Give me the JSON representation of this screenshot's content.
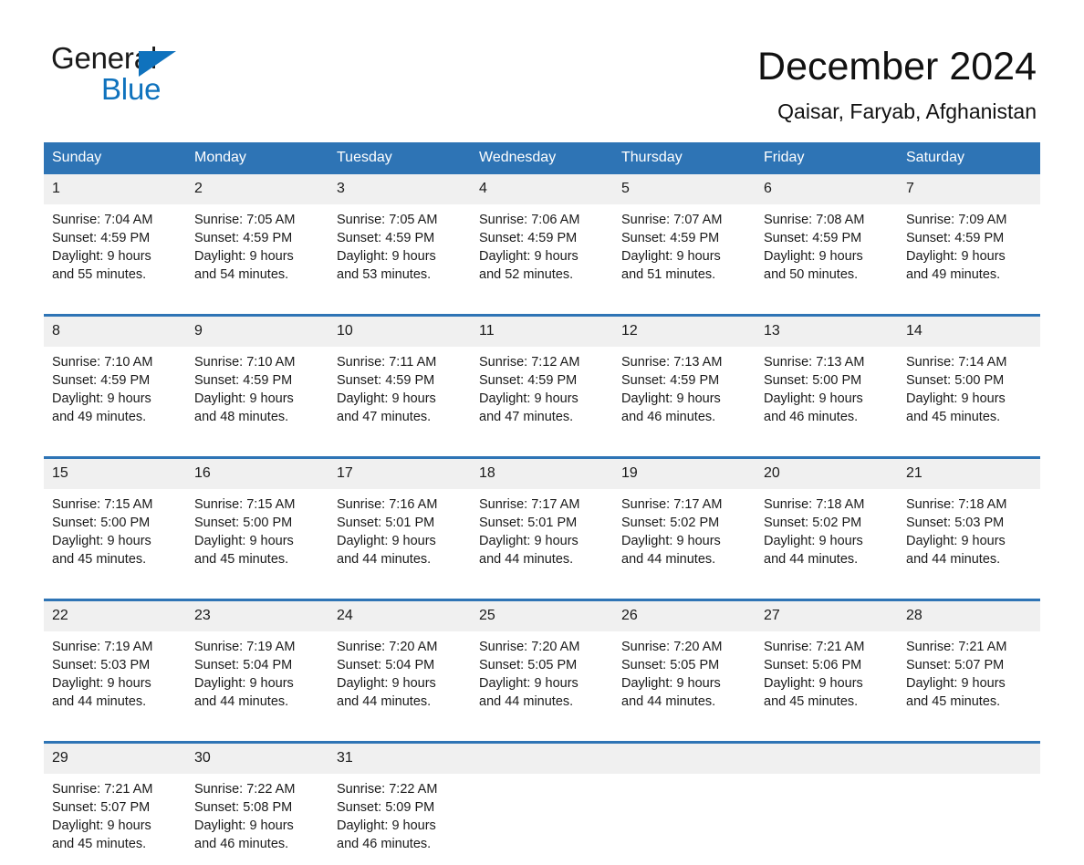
{
  "brand": {
    "name_part1": "General",
    "name_part2": "Blue",
    "triangle_color": "#0f72bd"
  },
  "header": {
    "title": "December 2024",
    "location": "Qaisar, Faryab, Afghanistan"
  },
  "theme": {
    "header_blue": "#2e74b5",
    "number_band": "#f0f0f0",
    "text": "#1a1a1a"
  },
  "calendar": {
    "day_names": [
      "Sunday",
      "Monday",
      "Tuesday",
      "Wednesday",
      "Thursday",
      "Friday",
      "Saturday"
    ],
    "weeks": [
      {
        "days": [
          {
            "num": "1",
            "l1": "Sunrise: 7:04 AM",
            "l2": "Sunset: 4:59 PM",
            "l3": "Daylight: 9 hours",
            "l4": "and 55 minutes."
          },
          {
            "num": "2",
            "l1": "Sunrise: 7:05 AM",
            "l2": "Sunset: 4:59 PM",
            "l3": "Daylight: 9 hours",
            "l4": "and 54 minutes."
          },
          {
            "num": "3",
            "l1": "Sunrise: 7:05 AM",
            "l2": "Sunset: 4:59 PM",
            "l3": "Daylight: 9 hours",
            "l4": "and 53 minutes."
          },
          {
            "num": "4",
            "l1": "Sunrise: 7:06 AM",
            "l2": "Sunset: 4:59 PM",
            "l3": "Daylight: 9 hours",
            "l4": "and 52 minutes."
          },
          {
            "num": "5",
            "l1": "Sunrise: 7:07 AM",
            "l2": "Sunset: 4:59 PM",
            "l3": "Daylight: 9 hours",
            "l4": "and 51 minutes."
          },
          {
            "num": "6",
            "l1": "Sunrise: 7:08 AM",
            "l2": "Sunset: 4:59 PM",
            "l3": "Daylight: 9 hours",
            "l4": "and 50 minutes."
          },
          {
            "num": "7",
            "l1": "Sunrise: 7:09 AM",
            "l2": "Sunset: 4:59 PM",
            "l3": "Daylight: 9 hours",
            "l4": "and 49 minutes."
          }
        ]
      },
      {
        "days": [
          {
            "num": "8",
            "l1": "Sunrise: 7:10 AM",
            "l2": "Sunset: 4:59 PM",
            "l3": "Daylight: 9 hours",
            "l4": "and 49 minutes."
          },
          {
            "num": "9",
            "l1": "Sunrise: 7:10 AM",
            "l2": "Sunset: 4:59 PM",
            "l3": "Daylight: 9 hours",
            "l4": "and 48 minutes."
          },
          {
            "num": "10",
            "l1": "Sunrise: 7:11 AM",
            "l2": "Sunset: 4:59 PM",
            "l3": "Daylight: 9 hours",
            "l4": "and 47 minutes."
          },
          {
            "num": "11",
            "l1": "Sunrise: 7:12 AM",
            "l2": "Sunset: 4:59 PM",
            "l3": "Daylight: 9 hours",
            "l4": "and 47 minutes."
          },
          {
            "num": "12",
            "l1": "Sunrise: 7:13 AM",
            "l2": "Sunset: 4:59 PM",
            "l3": "Daylight: 9 hours",
            "l4": "and 46 minutes."
          },
          {
            "num": "13",
            "l1": "Sunrise: 7:13 AM",
            "l2": "Sunset: 5:00 PM",
            "l3": "Daylight: 9 hours",
            "l4": "and 46 minutes."
          },
          {
            "num": "14",
            "l1": "Sunrise: 7:14 AM",
            "l2": "Sunset: 5:00 PM",
            "l3": "Daylight: 9 hours",
            "l4": "and 45 minutes."
          }
        ]
      },
      {
        "days": [
          {
            "num": "15",
            "l1": "Sunrise: 7:15 AM",
            "l2": "Sunset: 5:00 PM",
            "l3": "Daylight: 9 hours",
            "l4": "and 45 minutes."
          },
          {
            "num": "16",
            "l1": "Sunrise: 7:15 AM",
            "l2": "Sunset: 5:00 PM",
            "l3": "Daylight: 9 hours",
            "l4": "and 45 minutes."
          },
          {
            "num": "17",
            "l1": "Sunrise: 7:16 AM",
            "l2": "Sunset: 5:01 PM",
            "l3": "Daylight: 9 hours",
            "l4": "and 44 minutes."
          },
          {
            "num": "18",
            "l1": "Sunrise: 7:17 AM",
            "l2": "Sunset: 5:01 PM",
            "l3": "Daylight: 9 hours",
            "l4": "and 44 minutes."
          },
          {
            "num": "19",
            "l1": "Sunrise: 7:17 AM",
            "l2": "Sunset: 5:02 PM",
            "l3": "Daylight: 9 hours",
            "l4": "and 44 minutes."
          },
          {
            "num": "20",
            "l1": "Sunrise: 7:18 AM",
            "l2": "Sunset: 5:02 PM",
            "l3": "Daylight: 9 hours",
            "l4": "and 44 minutes."
          },
          {
            "num": "21",
            "l1": "Sunrise: 7:18 AM",
            "l2": "Sunset: 5:03 PM",
            "l3": "Daylight: 9 hours",
            "l4": "and 44 minutes."
          }
        ]
      },
      {
        "days": [
          {
            "num": "22",
            "l1": "Sunrise: 7:19 AM",
            "l2": "Sunset: 5:03 PM",
            "l3": "Daylight: 9 hours",
            "l4": "and 44 minutes."
          },
          {
            "num": "23",
            "l1": "Sunrise: 7:19 AM",
            "l2": "Sunset: 5:04 PM",
            "l3": "Daylight: 9 hours",
            "l4": "and 44 minutes."
          },
          {
            "num": "24",
            "l1": "Sunrise: 7:20 AM",
            "l2": "Sunset: 5:04 PM",
            "l3": "Daylight: 9 hours",
            "l4": "and 44 minutes."
          },
          {
            "num": "25",
            "l1": "Sunrise: 7:20 AM",
            "l2": "Sunset: 5:05 PM",
            "l3": "Daylight: 9 hours",
            "l4": "and 44 minutes."
          },
          {
            "num": "26",
            "l1": "Sunrise: 7:20 AM",
            "l2": "Sunset: 5:05 PM",
            "l3": "Daylight: 9 hours",
            "l4": "and 44 minutes."
          },
          {
            "num": "27",
            "l1": "Sunrise: 7:21 AM",
            "l2": "Sunset: 5:06 PM",
            "l3": "Daylight: 9 hours",
            "l4": "and 45 minutes."
          },
          {
            "num": "28",
            "l1": "Sunrise: 7:21 AM",
            "l2": "Sunset: 5:07 PM",
            "l3": "Daylight: 9 hours",
            "l4": "and 45 minutes."
          }
        ]
      },
      {
        "days": [
          {
            "num": "29",
            "l1": "Sunrise: 7:21 AM",
            "l2": "Sunset: 5:07 PM",
            "l3": "Daylight: 9 hours",
            "l4": "and 45 minutes."
          },
          {
            "num": "30",
            "l1": "Sunrise: 7:22 AM",
            "l2": "Sunset: 5:08 PM",
            "l3": "Daylight: 9 hours",
            "l4": "and 46 minutes."
          },
          {
            "num": "31",
            "l1": "Sunrise: 7:22 AM",
            "l2": "Sunset: 5:09 PM",
            "l3": "Daylight: 9 hours",
            "l4": "and 46 minutes."
          },
          {
            "num": "",
            "l1": "",
            "l2": "",
            "l3": "",
            "l4": ""
          },
          {
            "num": "",
            "l1": "",
            "l2": "",
            "l3": "",
            "l4": ""
          },
          {
            "num": "",
            "l1": "",
            "l2": "",
            "l3": "",
            "l4": ""
          },
          {
            "num": "",
            "l1": "",
            "l2": "",
            "l3": "",
            "l4": ""
          }
        ]
      }
    ]
  }
}
